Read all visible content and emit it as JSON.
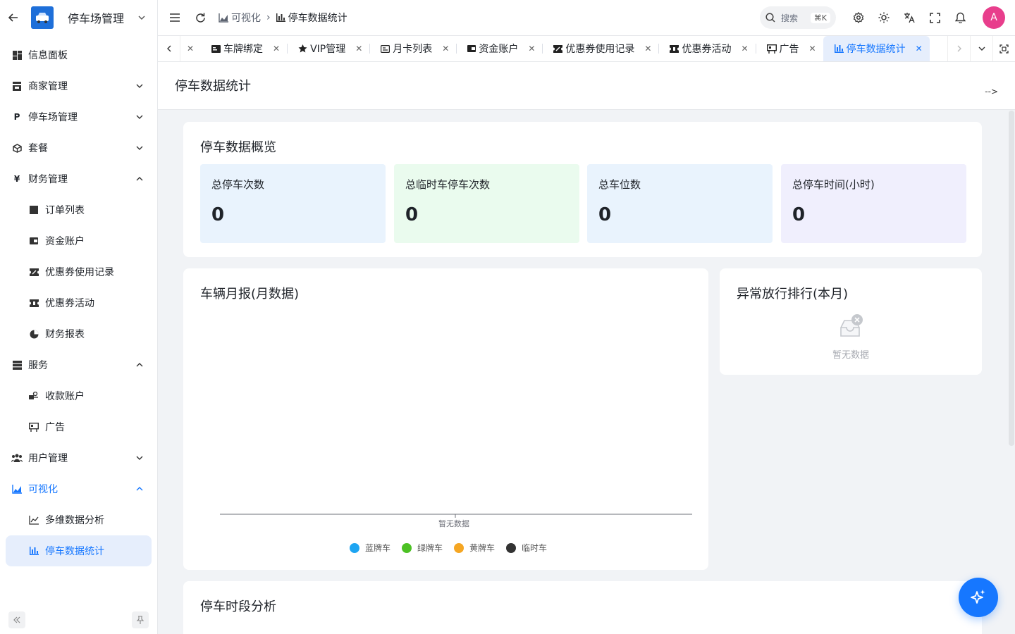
{
  "sidebar": {
    "title": "停车场管理",
    "items": [
      {
        "label": "信息面板"
      },
      {
        "label": "商家管理"
      },
      {
        "label": "停车场管理"
      },
      {
        "label": "套餐"
      },
      {
        "label": "财务管理"
      },
      {
        "label": "订单列表"
      },
      {
        "label": "资金账户"
      },
      {
        "label": "优惠券使用记录"
      },
      {
        "label": "优惠券活动"
      },
      {
        "label": "财务报表"
      },
      {
        "label": "服务"
      },
      {
        "label": "收款账户"
      },
      {
        "label": "广告"
      },
      {
        "label": "用户管理"
      },
      {
        "label": "可视化"
      },
      {
        "label": "多维数据分析"
      },
      {
        "label": "停车数据统计"
      }
    ]
  },
  "header": {
    "breadcrumb": [
      "可视化",
      "停车数据统计"
    ],
    "search_placeholder": "搜索",
    "search_shortcut": "⌘K",
    "avatar_letter": "A"
  },
  "tabs": [
    {
      "label": "车牌绑定"
    },
    {
      "label": "VIP管理"
    },
    {
      "label": "月卡列表"
    },
    {
      "label": "资金账户"
    },
    {
      "label": "优惠券使用记录"
    },
    {
      "label": "优惠券活动"
    },
    {
      "label": "广告"
    },
    {
      "label": "停车数据统计"
    }
  ],
  "page": {
    "title": "停车数据统计",
    "corner_text": "-->"
  },
  "overview": {
    "title": "停车数据概览",
    "stats": [
      {
        "label": "总停车次数",
        "value": "0",
        "bg": "#e9f3fd"
      },
      {
        "label": "总临时车停车次数",
        "value": "0",
        "bg": "#eafbee"
      },
      {
        "label": "总车位数",
        "value": "0",
        "bg": "#e9f3fd"
      },
      {
        "label": "总停车时间(小时)",
        "value": "0",
        "bg": "#f0effd"
      }
    ]
  },
  "monthly": {
    "title": "车辆月报(月数据)",
    "empty_text": "暂无数据",
    "legend": [
      {
        "name": "蓝牌车",
        "color": "#1ea5f2"
      },
      {
        "name": "绿牌车",
        "color": "#4cc124"
      },
      {
        "name": "黄牌车",
        "color": "#f5a623"
      },
      {
        "name": "临时车",
        "color": "#333333"
      }
    ]
  },
  "ranking": {
    "title": "异常放行排行(本月)",
    "empty_text": "暂无数据"
  },
  "period": {
    "title": "停车时段分析"
  }
}
